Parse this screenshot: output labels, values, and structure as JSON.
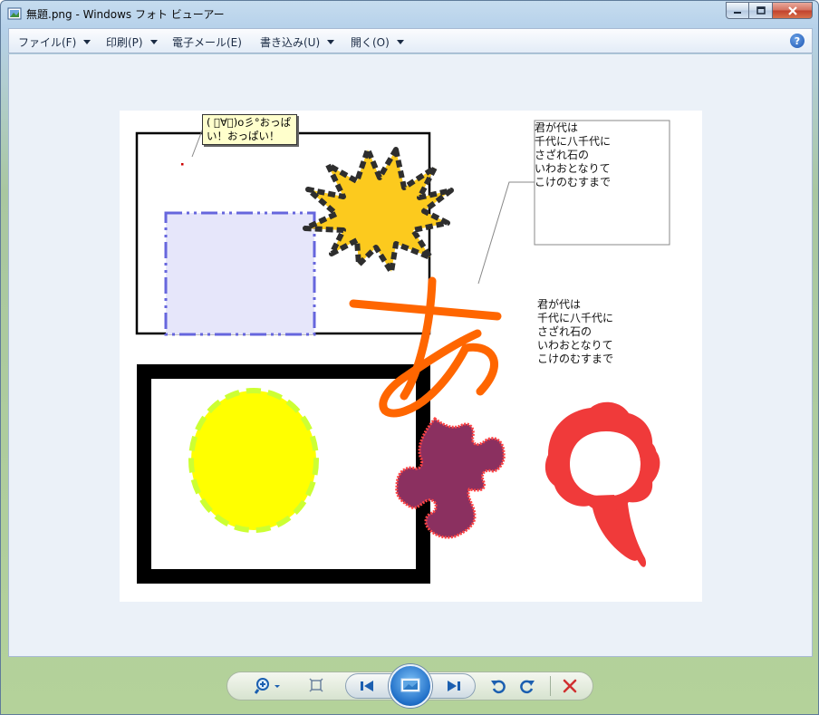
{
  "window": {
    "title": "無題.png - Windows フォト ビューアー"
  },
  "menu": {
    "items": [
      {
        "label": "ファイル(F)",
        "has_arrow": true
      },
      {
        "label": "印刷(P)",
        "has_arrow": true
      },
      {
        "label": "電子メール(E)",
        "has_arrow": false
      },
      {
        "label": "書き込み(U)",
        "has_arrow": true
      },
      {
        "label": "開く(O)",
        "has_arrow": true
      }
    ],
    "help_glyph": "?"
  },
  "image": {
    "callout_lines": [
      "( ﾟ∀ﾟ)o彡°おっぱ",
      "い！おっぱい！"
    ],
    "poem_box_lines": [
      "君が代は",
      "千代に八千代に",
      "さざれ石の",
      "いわおとなりて",
      "こけのむすまで"
    ],
    "poem_free_lines": [
      "君が代は",
      "千代に八千代に",
      "さざれ石の",
      "いわおとなりて",
      "こけのむすまで"
    ],
    "hiragana": "あ",
    "colors": {
      "starburst_fill": "#fcca1e",
      "starburst_outline": "#2e2e2e",
      "dash_rect_fill": "#e6e6fa",
      "dash_rect_outline": "#6666dd",
      "sun_fill": "#ffff00",
      "sun_outline": "#ccff33",
      "hiragana_stroke": "#ff6600",
      "puzzle_fill": "#8b3060",
      "puzzle_outline": "#ff4444",
      "ribbon": "#f03a3a"
    }
  },
  "toolbar": {
    "controls": [
      {
        "icon": "zoom-icon"
      },
      {
        "icon": "actual-size-icon"
      },
      {
        "icon": "previous-icon"
      },
      {
        "icon": "slideshow-icon"
      },
      {
        "icon": "next-icon"
      },
      {
        "icon": "rotate-counterclockwise-icon"
      },
      {
        "icon": "rotate-clockwise-icon"
      },
      {
        "icon": "delete-icon"
      }
    ]
  }
}
